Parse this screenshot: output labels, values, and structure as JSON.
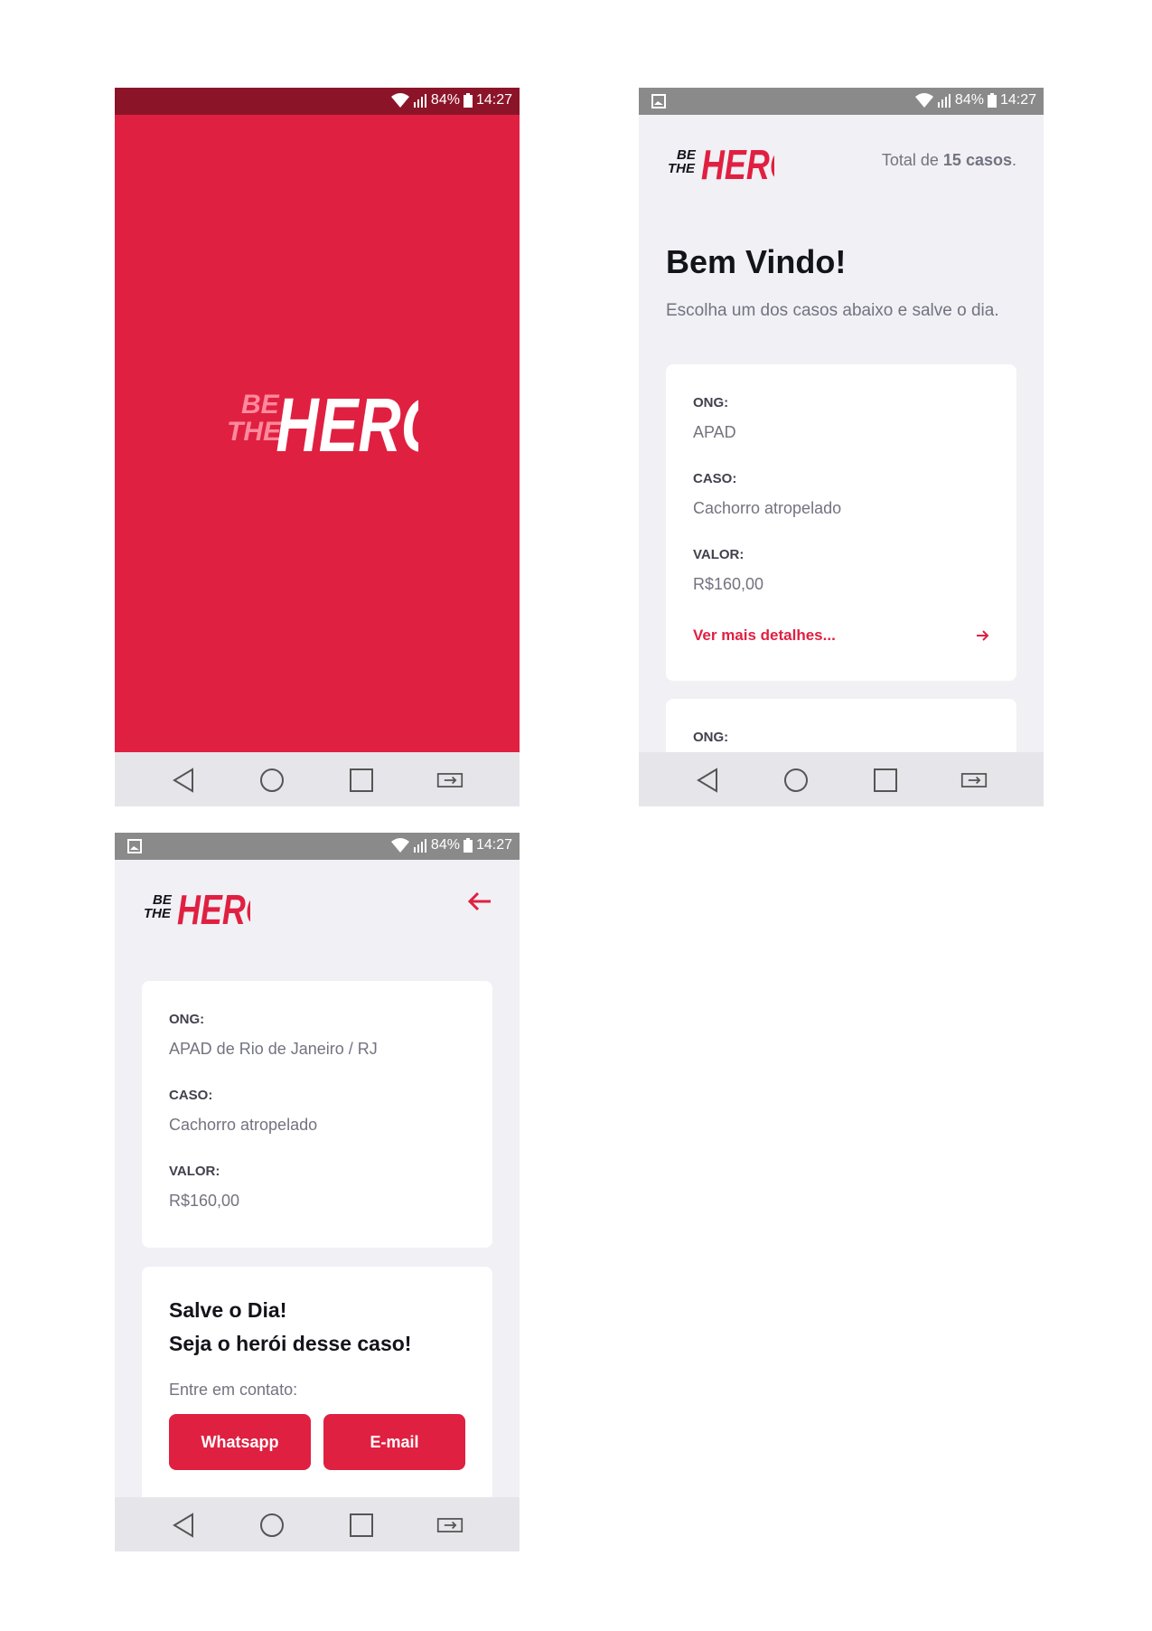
{
  "status_bar": {
    "battery": "84%",
    "time": "14:27"
  },
  "logo": {
    "small_top": "BE",
    "small_bottom": "THE",
    "big": "HERO"
  },
  "list": {
    "total_prefix": "Total de ",
    "total_count": "15 casos",
    "total_suffix": ".",
    "title": "Bem Vindo!",
    "subtitle": "Escolha um dos casos abaixo e salve o dia.",
    "incident": {
      "ong_label": "ONG:",
      "ong_value": "APAD",
      "caso_label": "CASO:",
      "caso_value": "Cachorro atropelado",
      "valor_label": "VALOR:",
      "valor_value": "R$160,00",
      "details_link": "Ver mais detalhes..."
    },
    "next_card_label": "ONG:"
  },
  "detail": {
    "ong_label": "ONG:",
    "ong_value": "APAD de Rio de Janeiro / RJ",
    "caso_label": "CASO:",
    "caso_value": "Cachorro atropelado",
    "valor_label": "VALOR:",
    "valor_value": "R$160,00",
    "hero_line1": "Salve o Dia!",
    "hero_line2": "Seja o herói desse caso!",
    "contact_label": "Entre em contato:",
    "whatsapp_button": "Whatsapp",
    "email_button": "E-mail"
  },
  "colors": {
    "brand": "#e02041",
    "background": "#f0f0f5",
    "title": "#13131a",
    "text": "#737380"
  }
}
